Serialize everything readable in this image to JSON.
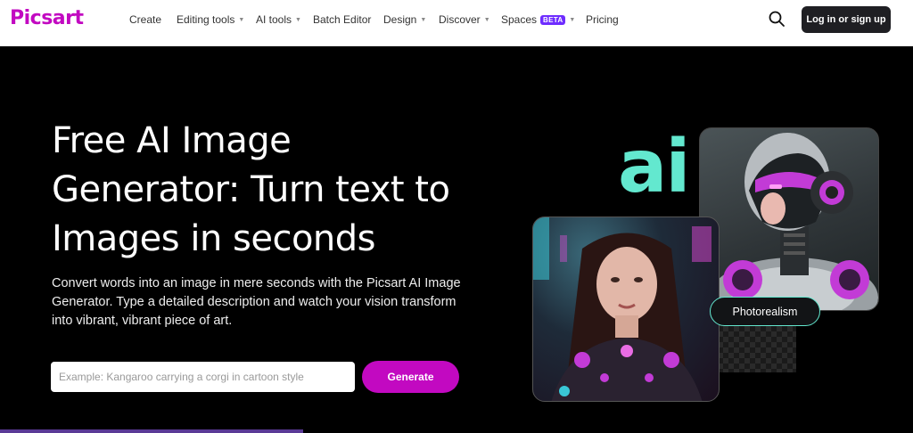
{
  "brand": {
    "logo": "Picsart",
    "color": "#c209c1"
  },
  "nav": {
    "items": [
      {
        "label": "Create",
        "caret": false
      },
      {
        "label": "Editing tools",
        "caret": true
      },
      {
        "label": "AI tools",
        "caret": true
      },
      {
        "label": "Batch Editor",
        "caret": false
      },
      {
        "label": "Design",
        "caret": true
      },
      {
        "label": "Discover",
        "caret": true
      },
      {
        "label": "Spaces",
        "badge": "BETA",
        "caret": true
      },
      {
        "label": "Pricing",
        "caret": false
      }
    ],
    "search_icon": "search-icon",
    "login_label": "Log in or sign up"
  },
  "hero": {
    "headline": "Free AI Image Generator: Turn text to Images in seconds",
    "subtitle": "Convert words into an image in mere seconds with the Picsart AI Image Generator. Type a detailed description and watch your vision transform into vibrant, vibrant piece of art.",
    "prompt_placeholder": "Example: Kangaroo carrying a corgi in cartoon style",
    "prompt_value": "",
    "generate_label": "Generate",
    "art_logo": "ai",
    "style_badge": "Photorealism",
    "accent_color": "#63e8cf",
    "background": "#000000"
  }
}
